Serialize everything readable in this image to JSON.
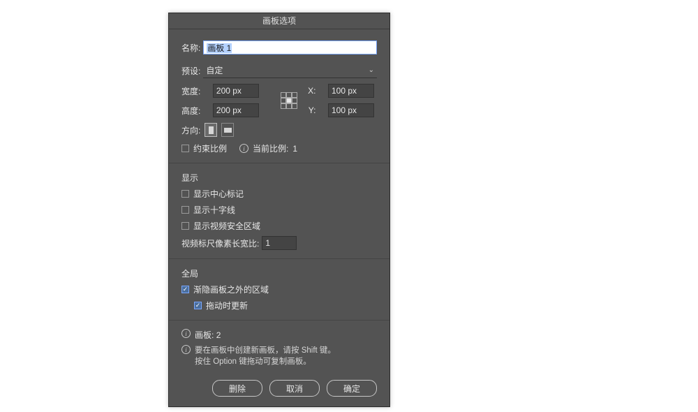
{
  "dialog": {
    "title": "画板选项",
    "name_label": "名称:",
    "name_value": "画板 1",
    "preset_label": "预设:",
    "preset_value": "自定",
    "width_label": "宽度:",
    "width_value": "200 px",
    "height_label": "高度:",
    "height_value": "200 px",
    "x_label": "X:",
    "x_value": "100 px",
    "y_label": "Y:",
    "y_value": "100 px",
    "orient_label": "方向:",
    "constrain_label": "约束比例",
    "current_ratio_label": "当前比例:",
    "current_ratio_value": "1",
    "display_section": "显示",
    "show_center_mark": "显示中心标记",
    "show_crosshair": "显示十字线",
    "show_video_safe": "显示视频安全区域",
    "video_par_label": "视频标尺像素长宽比:",
    "video_par_value": "1",
    "global_section": "全局",
    "fade_outside": "渐隐画板之外的区域",
    "update_on_drag": "拖动时更新",
    "artboard_count_label": "画板:",
    "artboard_count_value": "2",
    "help_line1": "要在画板中创建新画板，请按 Shift 键。",
    "help_line2": "按住 Option 键拖动可复制画板。",
    "btn_delete": "删除",
    "btn_cancel": "取消",
    "btn_ok": "确定"
  }
}
